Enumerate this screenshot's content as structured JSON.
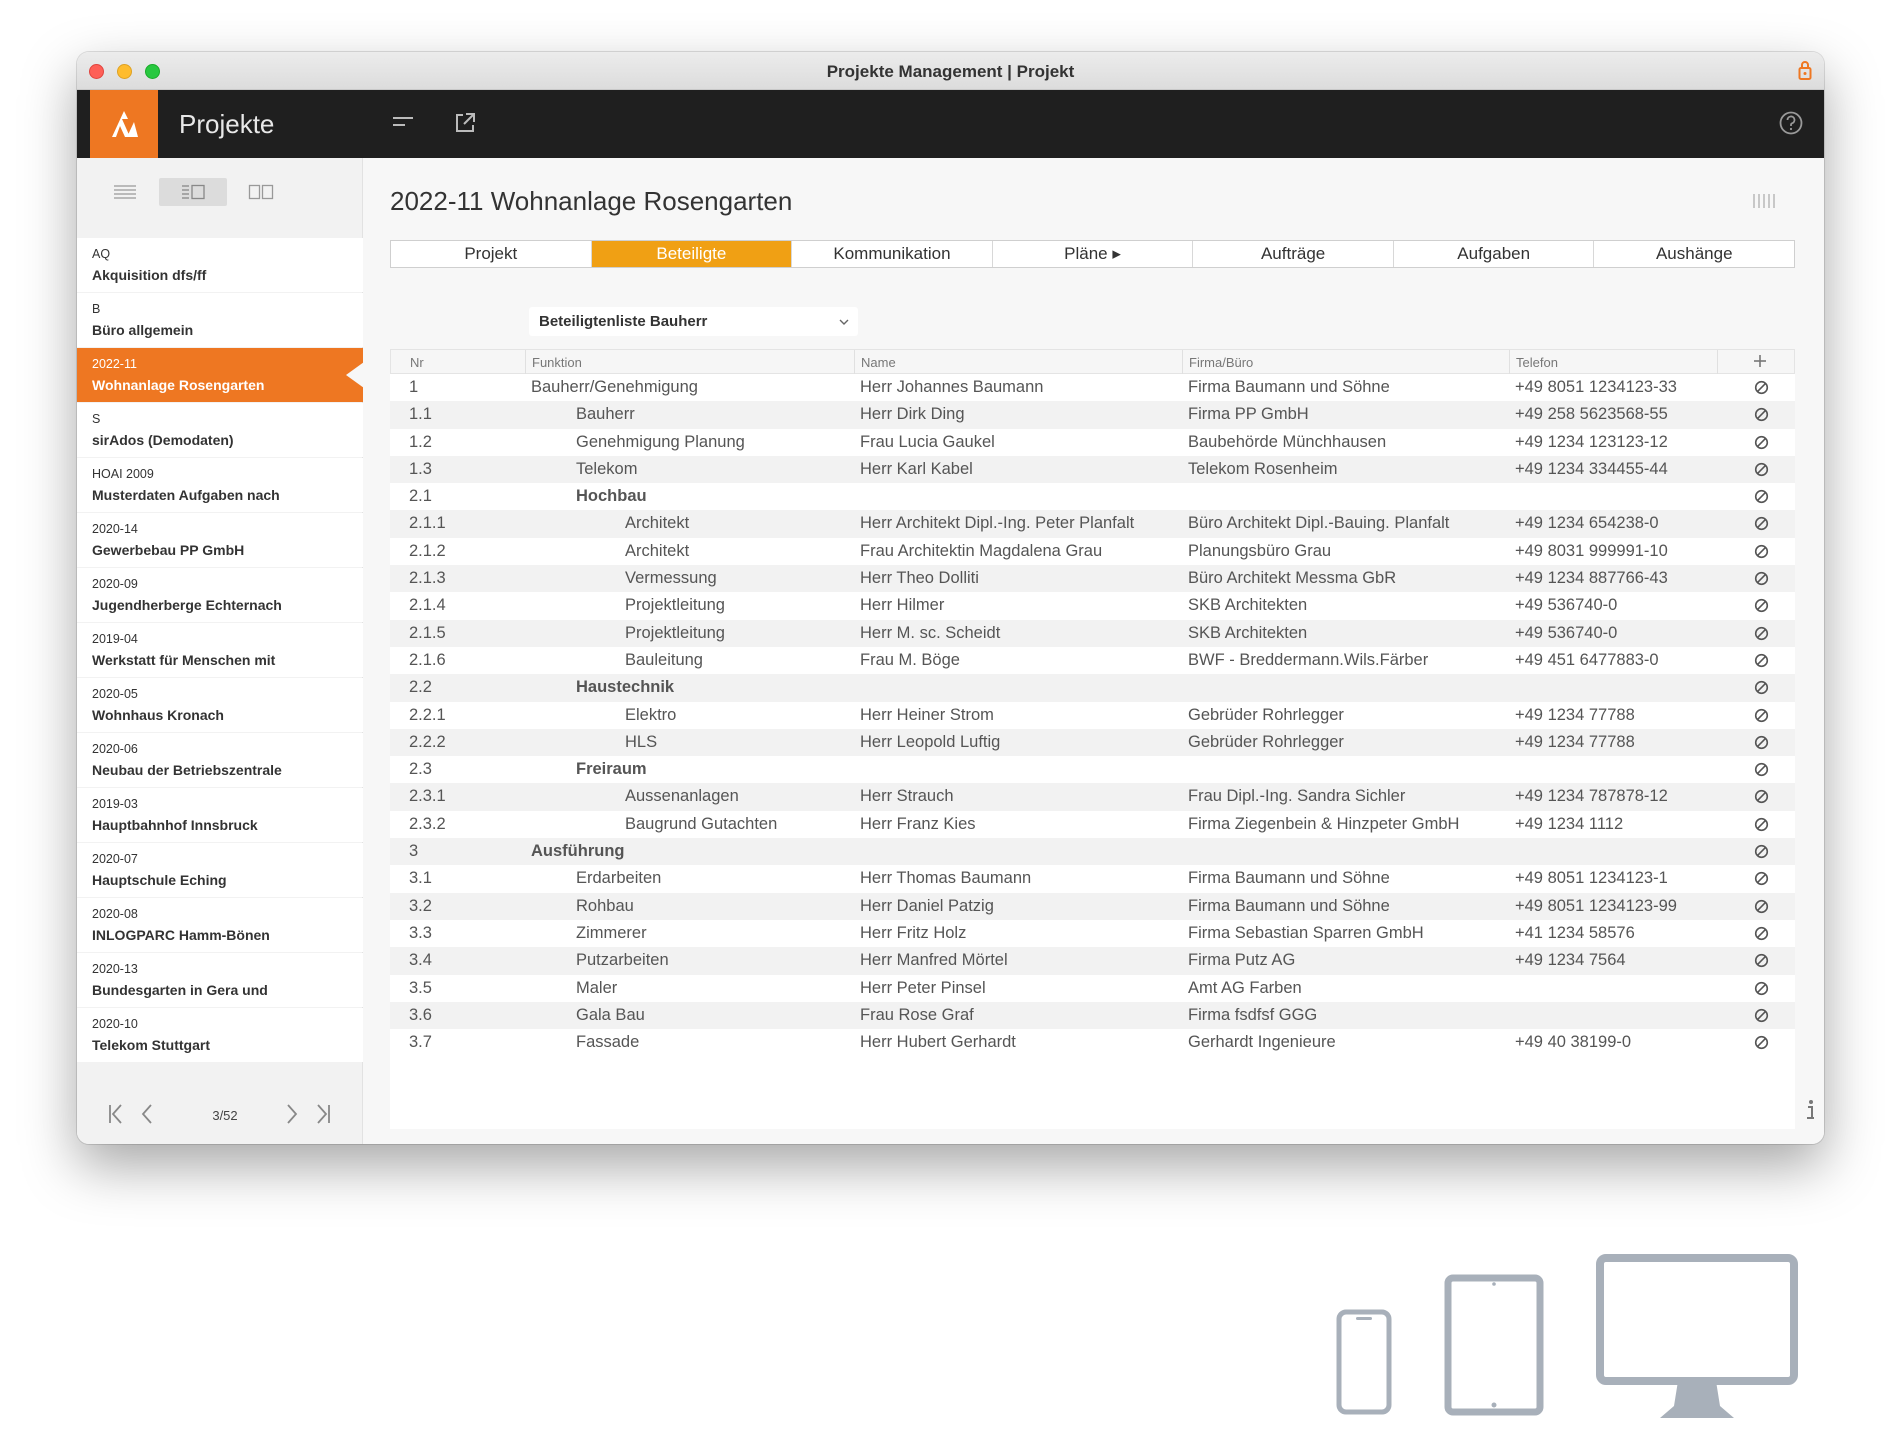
{
  "window": {
    "title": "Projekte Management | Projekt"
  },
  "app": {
    "name": "Projekte"
  },
  "sidebar": {
    "projects": [
      {
        "code": "AQ",
        "name": "Akquisition dfs/ff"
      },
      {
        "code": "B",
        "name": "Büro allgemein"
      },
      {
        "code": "2022-11",
        "name": "Wohnanlage Rosengarten",
        "active": true
      },
      {
        "code": "S",
        "name": "sirAdos (Demodaten)"
      },
      {
        "code": "HOAI 2009",
        "name": "Musterdaten Aufgaben nach"
      },
      {
        "code": "2020-14",
        "name": "Gewerbebau PP GmbH"
      },
      {
        "code": "2020-09",
        "name": "Jugendherberge Echternach"
      },
      {
        "code": "2019-04",
        "name": "Werkstatt für Menschen mit"
      },
      {
        "code": "2020-05",
        "name": "Wohnhaus Kronach"
      },
      {
        "code": "2020-06",
        "name": "Neubau der Betriebszentrale"
      },
      {
        "code": "2019-03",
        "name": "Hauptbahnhof Innsbruck"
      },
      {
        "code": "2020-07",
        "name": "Hauptschule Eching"
      },
      {
        "code": "2020-08",
        "name": "INLOGPARC Hamm-Bönen"
      },
      {
        "code": "2020-13",
        "name": "Bundesgarten in Gera und"
      },
      {
        "code": "2020-10",
        "name": "Telekom Stuttgart"
      }
    ],
    "pager": "3/52"
  },
  "main": {
    "project_title": "2022-11 Wohnanlage Rosengarten",
    "tabs": [
      "Projekt",
      "Beteiligte",
      "Kommunikation",
      "Pläne ▸",
      "Aufträge",
      "Aufgaben",
      "Aushänge"
    ],
    "active_tab": 1,
    "dropdown": "Beteiligtenliste Bauherr",
    "table": {
      "headers": {
        "nr": "Nr",
        "funktion": "Funktion",
        "name": "Name",
        "firma": "Firma/Büro",
        "telefon": "Telefon"
      },
      "rows": [
        {
          "nr": "1",
          "funktion": "Bauherr/Genehmigung",
          "level": 1,
          "bold": false,
          "name": "Herr Johannes Baumann",
          "firma": "Firma Baumann und Söhne",
          "tel": "+49 8051 1234123-33"
        },
        {
          "nr": "1.1",
          "funktion": "Bauherr",
          "level": 2,
          "bold": false,
          "name": "Herr Dirk Ding",
          "firma": "Firma PP GmbH",
          "tel": "+49 258 5623568-55"
        },
        {
          "nr": "1.2",
          "funktion": "Genehmigung Planung",
          "level": 2,
          "bold": false,
          "name": "Frau Lucia Gaukel",
          "firma": "Baubehörde Münchhausen",
          "tel": "+49 1234 123123-12"
        },
        {
          "nr": "1.3",
          "funktion": "Telekom",
          "level": 2,
          "bold": false,
          "name": "Herr Karl Kabel",
          "firma": "Telekom Rosenheim",
          "tel": "+49 1234 334455-44"
        },
        {
          "nr": "2.1",
          "funktion": "Hochbau",
          "level": 2,
          "bold": true,
          "name": "",
          "firma": "",
          "tel": ""
        },
        {
          "nr": "2.1.1",
          "funktion": "Architekt",
          "level": 3,
          "bold": false,
          "name": "Herr Architekt Dipl.-Ing. Peter Planfalt",
          "firma": "Büro Architekt Dipl.-Bauing. Planfalt",
          "tel": "+49 1234 654238-0"
        },
        {
          "nr": "2.1.2",
          "funktion": "Architekt",
          "level": 3,
          "bold": false,
          "name": "Frau Architektin Magdalena Grau",
          "firma": "Planungsbüro Grau",
          "tel": "+49 8031 999991-10"
        },
        {
          "nr": "2.1.3",
          "funktion": "Vermessung",
          "level": 3,
          "bold": false,
          "name": "Herr Theo Dolliti",
          "firma": "Büro Architekt Messma GbR",
          "tel": "+49 1234 887766-43"
        },
        {
          "nr": "2.1.4",
          "funktion": "Projektleitung",
          "level": 3,
          "bold": false,
          "name": "Herr Hilmer",
          "firma": "SKB Architekten",
          "tel": "+49 536740-0"
        },
        {
          "nr": "2.1.5",
          "funktion": "Projektleitung",
          "level": 3,
          "bold": false,
          "name": "Herr M. sc. Scheidt",
          "firma": "SKB Architekten",
          "tel": "+49 536740-0"
        },
        {
          "nr": "2.1.6",
          "funktion": "Bauleitung",
          "level": 3,
          "bold": false,
          "name": "Frau M. Böge",
          "firma": "BWF - Breddermann.Wils.Färber",
          "tel": "+49 451 6477883-0"
        },
        {
          "nr": "2.2",
          "funktion": "Haustechnik",
          "level": 2,
          "bold": true,
          "name": "",
          "firma": "",
          "tel": ""
        },
        {
          "nr": "2.2.1",
          "funktion": "Elektro",
          "level": 3,
          "bold": false,
          "name": "Herr Heiner Strom",
          "firma": "Gebrüder Rohrlegger",
          "tel": "+49 1234 77788"
        },
        {
          "nr": "2.2.2",
          "funktion": "HLS",
          "level": 3,
          "bold": false,
          "name": "Herr Leopold Luftig",
          "firma": "Gebrüder Rohrlegger",
          "tel": "+49 1234 77788"
        },
        {
          "nr": "2.3",
          "funktion": "Freiraum",
          "level": 2,
          "bold": true,
          "name": "",
          "firma": "",
          "tel": ""
        },
        {
          "nr": "2.3.1",
          "funktion": "Aussenanlagen",
          "level": 3,
          "bold": false,
          "name": "Herr Strauch",
          "firma": "Frau Dipl.-Ing. Sandra Sichler",
          "tel": "+49 1234 787878-12"
        },
        {
          "nr": "2.3.2",
          "funktion": "Baugrund Gutachten",
          "level": 3,
          "bold": false,
          "name": "Herr Franz Kies",
          "firma": "Firma Ziegenbein & Hinzpeter GmbH",
          "tel": "+49 1234 1112"
        },
        {
          "nr": "3",
          "funktion": "Ausführung",
          "level": 1,
          "bold": true,
          "name": "",
          "firma": "",
          "tel": ""
        },
        {
          "nr": "3.1",
          "funktion": "Erdarbeiten",
          "level": 2,
          "bold": false,
          "name": "Herr Thomas Baumann",
          "firma": "Firma Baumann und Söhne",
          "tel": "+49 8051 1234123-1"
        },
        {
          "nr": "3.2",
          "funktion": "Rohbau",
          "level": 2,
          "bold": false,
          "name": "Herr Daniel Patzig",
          "firma": "Firma Baumann und Söhne",
          "tel": "+49 8051 1234123-99"
        },
        {
          "nr": "3.3",
          "funktion": "Zimmerer",
          "level": 2,
          "bold": false,
          "name": "Herr Fritz Holz",
          "firma": "Firma Sebastian Sparren GmbH",
          "tel": "+41 1234 58576"
        },
        {
          "nr": "3.4",
          "funktion": "Putzarbeiten",
          "level": 2,
          "bold": false,
          "name": "Herr Manfred Mörtel",
          "firma": "Firma Putz AG",
          "tel": "+49 1234 7564"
        },
        {
          "nr": "3.5",
          "funktion": "Maler",
          "level": 2,
          "bold": false,
          "name": "Herr Peter Pinsel",
          "firma": "Amt AG Farben",
          "tel": ""
        },
        {
          "nr": "3.6",
          "funktion": "Gala Bau",
          "level": 2,
          "bold": false,
          "name": "Frau Rose Graf",
          "firma": "Firma fsdfsf GGG",
          "tel": ""
        },
        {
          "nr": "3.7",
          "funktion": "Fassade",
          "level": 2,
          "bold": false,
          "name": "Herr Hubert Gerhardt",
          "firma": "Gerhardt Ingenieure",
          "tel": "+49 40 38199-0"
        }
      ]
    }
  },
  "colors": {
    "accent": "#ee7722",
    "tab_active": "#f0a014",
    "topbar": "#1f1f1f",
    "device_icons": "#a8b0ba"
  },
  "icons": [
    "lock-icon",
    "app-logo-icon",
    "menu-icon",
    "external-link-icon",
    "help-icon",
    "list-view-icon",
    "split-view-icon",
    "dual-view-icon",
    "first-page-icon",
    "prev-page-icon",
    "next-page-icon",
    "last-page-icon",
    "barcode-icon",
    "chevron-down-icon",
    "add-icon",
    "remove-icon",
    "info-icon",
    "phone-icon",
    "tablet-icon",
    "desktop-icon"
  ]
}
